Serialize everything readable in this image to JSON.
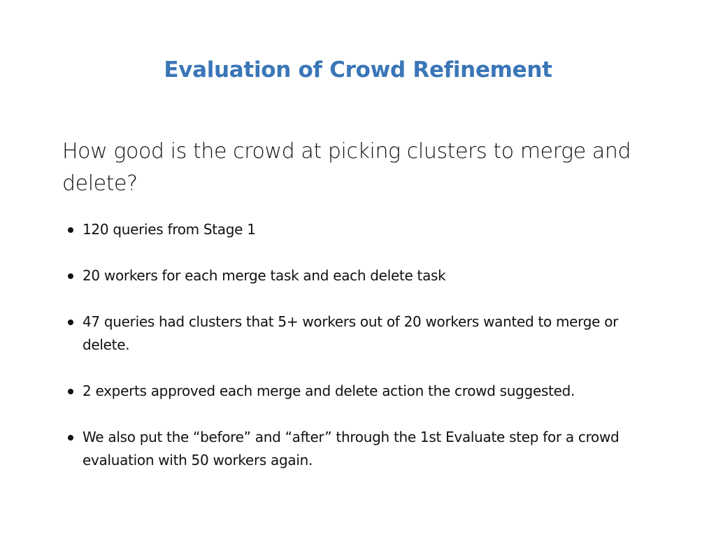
{
  "slide": {
    "title": "Evaluation of Crowd Refinement",
    "subtitle": "How good is the crowd at picking clusters to merge and delete?",
    "title_color": "#3a76b8",
    "bullets": [
      "120 queries from Stage 1",
      "20 workers for each merge task and each delete task",
      "47 queries had clusters that 5+ workers out of 20 workers wanted to merge or delete.",
      "2 experts approved each merge and delete action the crowd suggested.",
      "We also put the “before” and “after” through the 1st Evaluate step for a crowd evaluation with 50 workers again."
    ]
  }
}
